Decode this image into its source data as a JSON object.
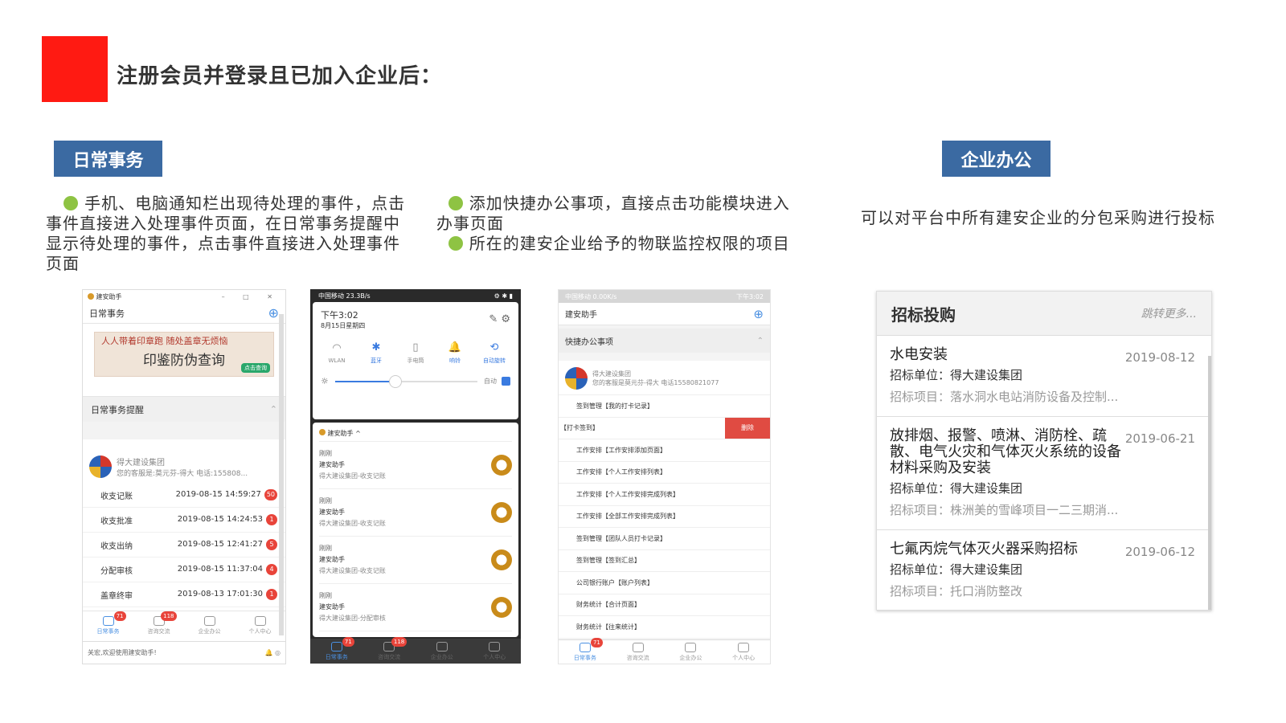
{
  "title": "注册会员并登录且已加入企业后：",
  "tags": {
    "daily": "日常事务",
    "enterprise": "企业办公"
  },
  "paras": {
    "p1": "手机、电脑通知栏出现待处理的事件，点击事件直接进入处理事件页面，在日常事务提醒中显示待处理的事件，点击事件直接进入处理事件页面",
    "p2a": "添加快捷办公事项，直接点击功能模块进入办事页面",
    "p2b": "所在的建安企业给予的物联监控权限的项目",
    "p3": "可以对平台中所有建安企业的分包采购进行投标"
  },
  "s1": {
    "app": "建安助手",
    "header": "日常事务",
    "banner": {
      "line": "人人带着印章跑",
      "line2": "随处盖章无烦恼",
      "main": "印鉴防伪查询",
      "btn": "点击查询"
    },
    "reminder": "日常事务提醒",
    "company": "得大建设集团",
    "desc": "您的客服是:莫元芬-得大 电话:155808...",
    "items": [
      {
        "label": "收支记账",
        "time": "2019-08-15 14:59:27",
        "count": "50"
      },
      {
        "label": "收支批准",
        "time": "2019-08-15 14:24:53",
        "count": "1"
      },
      {
        "label": "收支出纳",
        "time": "2019-08-15 12:41:27",
        "count": "5"
      },
      {
        "label": "分配审核",
        "time": "2019-08-15 11:37:04",
        "count": "4"
      },
      {
        "label": "盖章终审",
        "time": "2019-08-13 17:01:30",
        "count": "1"
      }
    ],
    "tabs": [
      {
        "label": "日常事务",
        "badge": "71"
      },
      {
        "label": "咨询交流",
        "badge": "118"
      },
      {
        "label": "企业办公",
        "badge": ""
      },
      {
        "label": "个人中心",
        "badge": ""
      }
    ],
    "status": "关宏,欢迎使用建安助手!"
  },
  "s2": {
    "status": "中国移动 23.3B/s",
    "time": "下午3:02",
    "date": "8月15日星期四",
    "toggles": [
      "WLAN",
      "蓝牙",
      "手电筒",
      "响铃",
      "自动旋转"
    ],
    "auto": "自动",
    "app": "建安助手",
    "notes": [
      {
        "when": "刚刚",
        "title": "建安助手",
        "body": "得大建设集团-收支记账"
      },
      {
        "when": "刚刚",
        "title": "建安助手",
        "body": "得大建设集团-收支记账"
      },
      {
        "when": "刚刚",
        "title": "建安助手",
        "body": "得大建设集团-收支记账"
      },
      {
        "when": "刚刚",
        "title": "建安助手",
        "body": "得大建设集团-分配审核"
      }
    ]
  },
  "s3": {
    "status": "中国移动 0.00K/s",
    "status_r": "下午3:02",
    "app": "建安助手",
    "quick": "快捷办公事项",
    "company": "得大建设集团",
    "desc": "您的客服是莫元芬-得大 电话15580821077",
    "items": [
      "签到管理【我的打卡记录】",
      "【打卡签到】",
      "工作安排【工作安排添加页面】",
      "工作安排【个人工作安排列表】",
      "工作安排【个人工作安排完成列表】",
      "工作安排【全部工作安排完成列表】",
      "签到管理【团队人员打卡记录】",
      "签到管理【签到汇总】",
      "公司银行账户【账户列表】",
      "财务统计【合计页面】",
      "财务统计【往来统计】"
    ],
    "delete": "删除"
  },
  "bids": {
    "title": "招标投购",
    "more": "跳转更多...",
    "unit_label": "招标单位：",
    "proj_label": "招标项目：",
    "list": [
      {
        "title": "水电安装",
        "date": "2019-08-12",
        "unit": "得大建设集团",
        "proj": "落水洞水电站消防设备及控制..."
      },
      {
        "title": "放排烟、报警、喷淋、消防栓、疏散、电气火灾和气体灭火系统的设备材料采购及安装",
        "date": "2019-06-21",
        "unit": "得大建设集团",
        "proj": "株洲美的雪峰项目一二三期消..."
      },
      {
        "title": "七氟丙烷气体灭火器采购招标",
        "date": "2019-06-12",
        "unit": "得大建设集团",
        "proj": "托口消防整改"
      }
    ]
  }
}
